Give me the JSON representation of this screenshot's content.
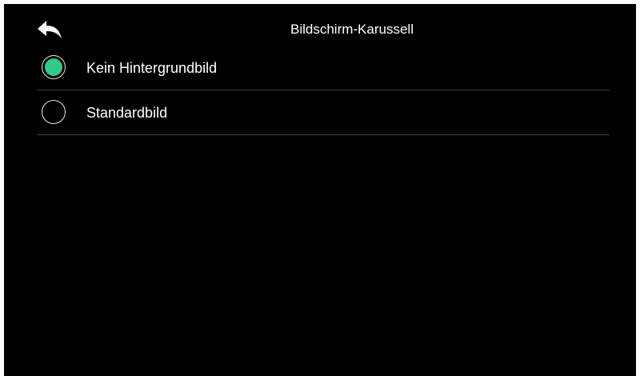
{
  "header": {
    "title": "Bildschirm-Karussell",
    "back_icon": "back-arrow-icon"
  },
  "options": [
    {
      "label": "Kein Hintergrundbild",
      "selected": true
    },
    {
      "label": "Standardbild",
      "selected": false
    }
  ],
  "colors": {
    "background": "#000000",
    "accent": "#34c98b",
    "text": "#ffffff",
    "divider": "#3a3a3a"
  }
}
